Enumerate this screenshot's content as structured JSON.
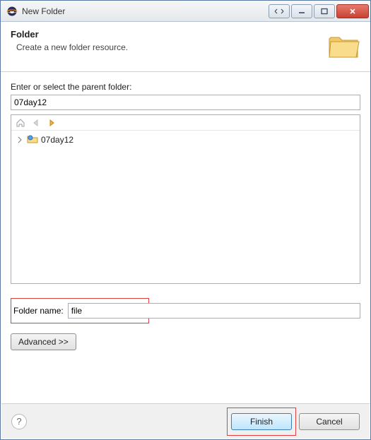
{
  "window": {
    "title": "New Folder"
  },
  "header": {
    "heading": "Folder",
    "description": "Create a new folder resource."
  },
  "parent_section": {
    "label": "Enter or select the parent folder:",
    "value": "07day12",
    "tree_item": "07day12"
  },
  "folder_name": {
    "label": "Folder name:",
    "value": "file"
  },
  "buttons": {
    "advanced": "Advanced >>",
    "finish": "Finish",
    "cancel": "Cancel"
  }
}
